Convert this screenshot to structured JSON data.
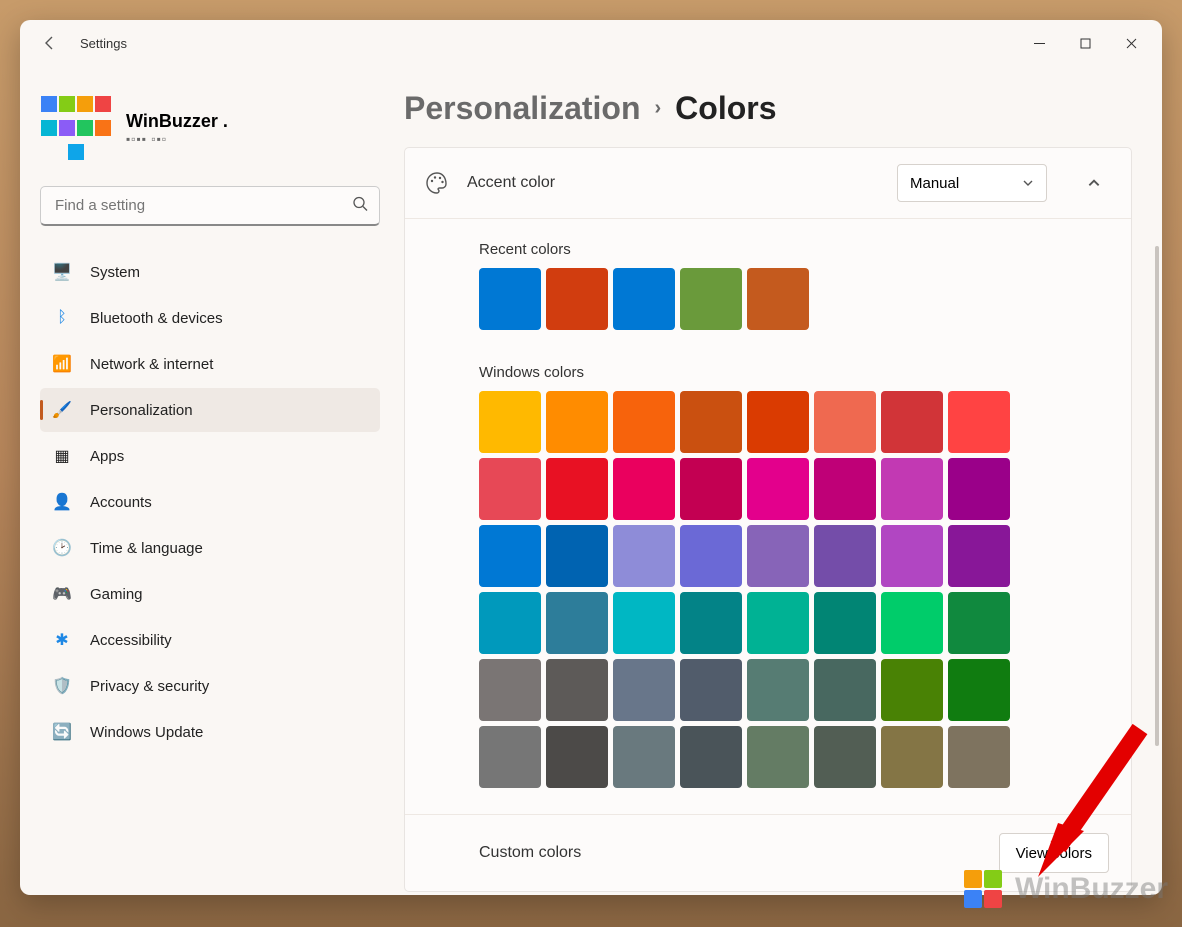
{
  "window_title": "Settings",
  "profile": {
    "name": "WinBuzzer ."
  },
  "search": {
    "placeholder": "Find a setting"
  },
  "sidebar": {
    "items": [
      {
        "label": "System"
      },
      {
        "label": "Bluetooth & devices"
      },
      {
        "label": "Network & internet"
      },
      {
        "label": "Personalization"
      },
      {
        "label": "Apps"
      },
      {
        "label": "Accounts"
      },
      {
        "label": "Time & language"
      },
      {
        "label": "Gaming"
      },
      {
        "label": "Accessibility"
      },
      {
        "label": "Privacy & security"
      },
      {
        "label": "Windows Update"
      }
    ]
  },
  "breadcrumb": {
    "parent": "Personalization",
    "current": "Colors"
  },
  "accent": {
    "title": "Accent color",
    "mode": "Manual",
    "recent_label": "Recent colors",
    "recent_colors": [
      "#0078d4",
      "#d13d0f",
      "#0078d4",
      "#6a9a3b",
      "#c45a1e"
    ],
    "windows_label": "Windows colors",
    "windows_colors": [
      "#ffb900",
      "#ff8c00",
      "#f7630c",
      "#ca5010",
      "#da3b01",
      "#ef6950",
      "#d13438",
      "#ff4343",
      "#e74856",
      "#e81123",
      "#ea005e",
      "#c30052",
      "#e3008c",
      "#bf0077",
      "#c239b3",
      "#9a0089",
      "#0078d4",
      "#0063b1",
      "#8e8cd8",
      "#6b69d6",
      "#8764b8",
      "#744da9",
      "#b146c2",
      "#881798",
      "#0099bc",
      "#2d7d9a",
      "#00b7c3",
      "#038387",
      "#00b294",
      "#018574",
      "#00cc6a",
      "#10893e",
      "#7a7574",
      "#5d5a58",
      "#68768a",
      "#515c6b",
      "#567c73",
      "#486860",
      "#498205",
      "#107c10",
      "#767676",
      "#4c4a48",
      "#69797e",
      "#4a5459",
      "#647c64",
      "#525e54",
      "#847545",
      "#7e735f"
    ]
  },
  "custom": {
    "label": "Custom colors",
    "button": "View colors"
  },
  "watermark": "WinBuzzer"
}
